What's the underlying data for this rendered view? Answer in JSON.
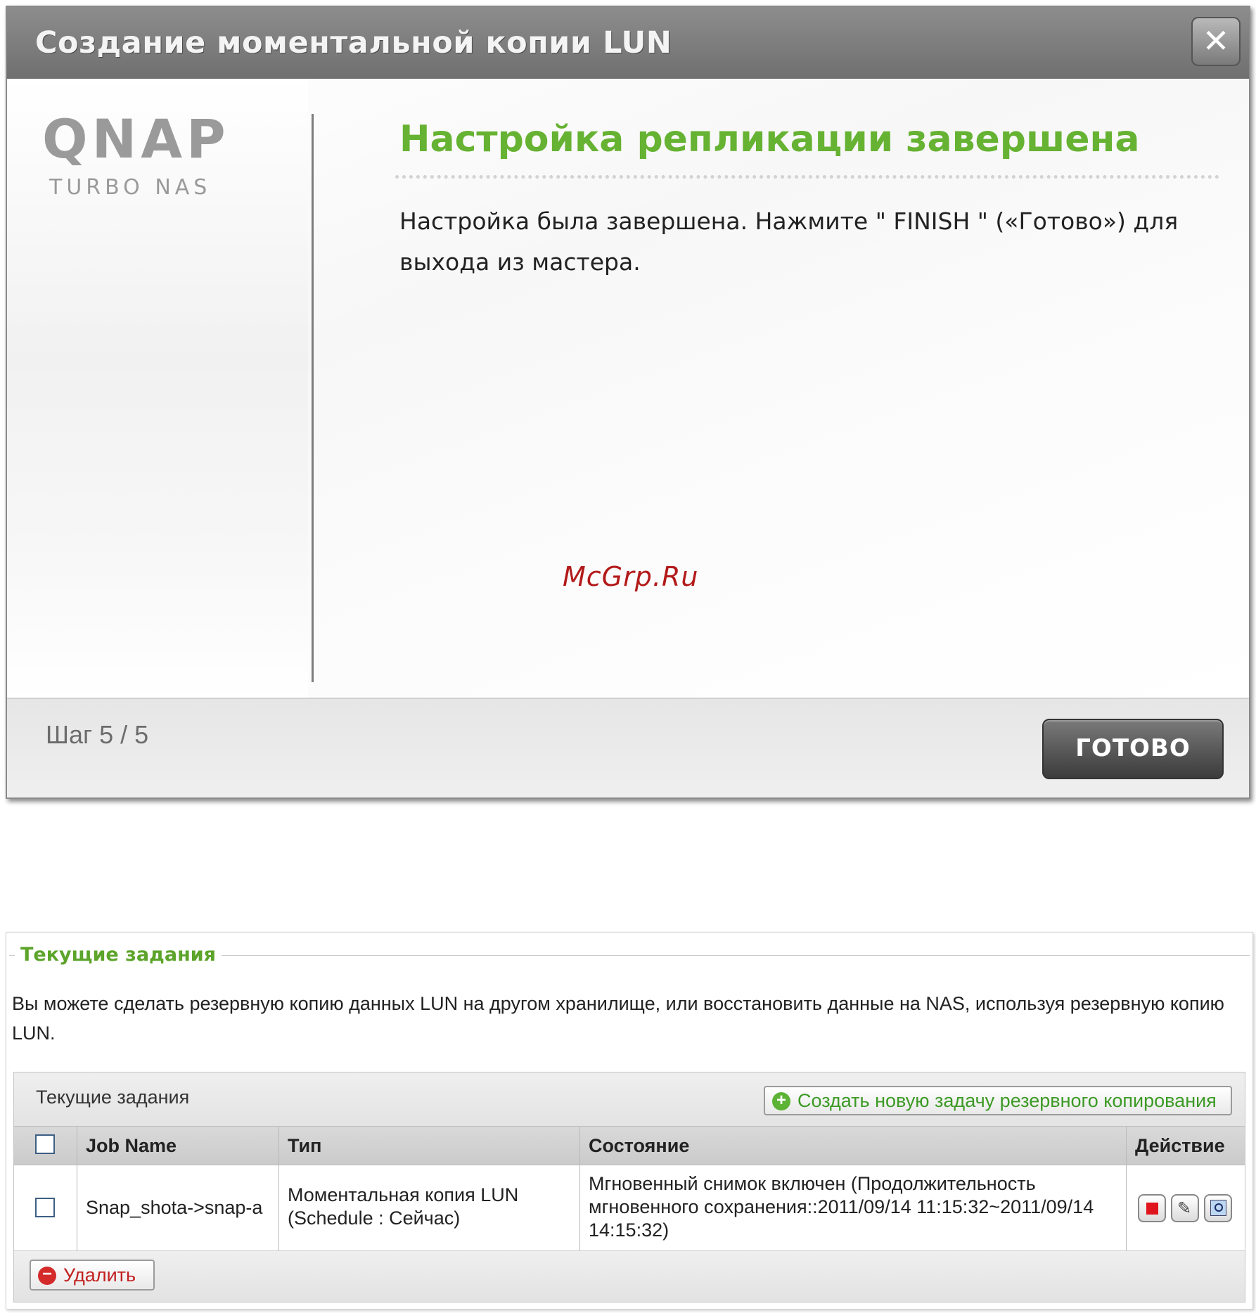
{
  "wizard": {
    "title": "Создание моментальной копии LUN",
    "close_glyph": "✕",
    "logo": {
      "brand": "QNAP",
      "product": "TURBO NAS"
    },
    "heading": "Настройка репликации завершена",
    "description": "Настройка была завершена. Нажмите \" FINISH \" («Готово») для выхода из мастера.",
    "step": "Шаг 5 / 5",
    "finish_label": "ГОТОВО"
  },
  "watermark": "McGrp.Ru",
  "jobs_panel": {
    "legend": "Текущие задания",
    "intro": "Вы можете сделать резервную копию данных LUN на другом хранилище, или восстановить данные на NAS, используя резервную копию LUN.",
    "grid_title": "Текущие задания",
    "create_label": "Создать новую задачу резервного копирования",
    "columns": {
      "job_name": "Job Name",
      "type": "Тип",
      "state": "Состояние",
      "action": "Действие"
    },
    "rows": [
      {
        "selected": false,
        "job_name": "Snap_shota->snap-a",
        "type": "Моментальная копия LUN  (Schedule : Сейчас)",
        "state": "Мгновенный снимок включен  (Продолжительность мгновенного сохранения::2011/09/14 11:15:32~2011/09/14 14:15:32)",
        "actions": [
          "stop-icon",
          "edit-icon",
          "view-icon"
        ]
      }
    ],
    "delete_label": "Удалить"
  },
  "colors": {
    "accent_green": "#66b232",
    "title_bar": "#7d7d7d",
    "delete_red": "#c21f1f",
    "watermark_red": "#b31a1a"
  }
}
